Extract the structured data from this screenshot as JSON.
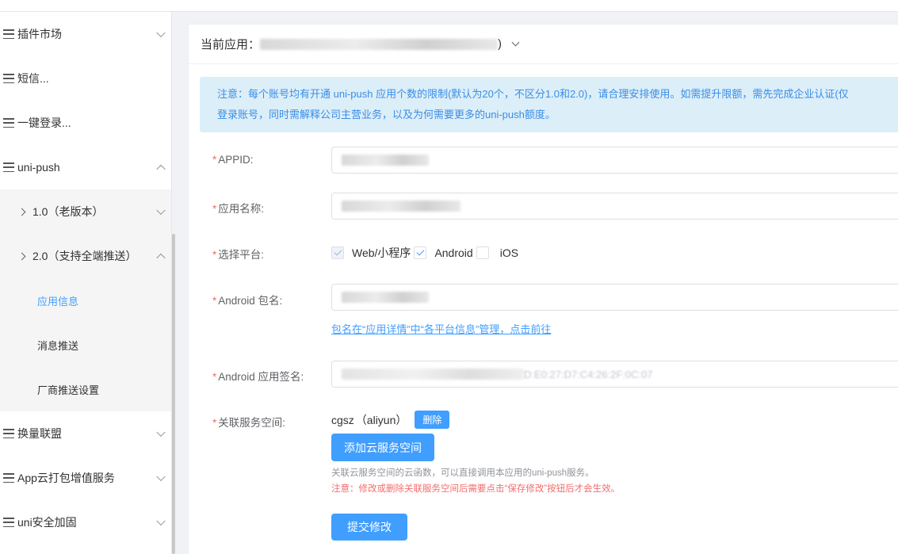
{
  "sidebar": {
    "items": [
      {
        "label": "插件市场"
      },
      {
        "label": "短信..."
      },
      {
        "label": "一键登录..."
      },
      {
        "label": "uni-push"
      }
    ],
    "sub": {
      "v1": "1.0（老版本）",
      "v2": "2.0（支持全端推送）",
      "leaves": [
        "应用信息",
        "消息推送",
        "厂商推送设置"
      ]
    },
    "bottom_items": [
      {
        "label": "换量联盟"
      },
      {
        "label": "App云打包增值服务"
      },
      {
        "label": "uni安全加固"
      }
    ]
  },
  "header": {
    "current_app_label": "当前应用：",
    "app_suffix": ")"
  },
  "notice": {
    "line1": "注意：每个账号均有开通 uni-push 应用个数的限制(默认为20个，不区分1.0和2.0)，请合理安排使用。如需提升限额，需先完成企业认证(仅",
    "line2": "登录账号，同时需解释公司主营业务，以及为何需要更多的uni-push额度。"
  },
  "form": {
    "required_mark": "*",
    "appid_label": "APPID:",
    "appname_label": "应用名称:",
    "platform_label": "选择平台:",
    "platforms": [
      "Web/小程序",
      "Android",
      "iOS"
    ],
    "android_pkg_label": "Android 包名:",
    "pkg_link": "包名在“应用详情”中“各平台信息”管理，点击前往",
    "android_sign_label": "Android 应用签名:",
    "android_sign_suffix": "D:E0:27:D7:C4:26:2F:0C:07",
    "space_label": "关联服务空间:",
    "space_name": "cgsz",
    "space_provider": "（aliyun）",
    "delete_label": "删除",
    "add_space_label": "添加云服务空间",
    "hint": "关联云服务空间的云函数，可以直接调用本应用的uni-push服务。",
    "warn": "注意：修改或删除关联服务空间后需要点击“保存修改”按钮后才会生效。",
    "submit_label": "提交修改"
  }
}
